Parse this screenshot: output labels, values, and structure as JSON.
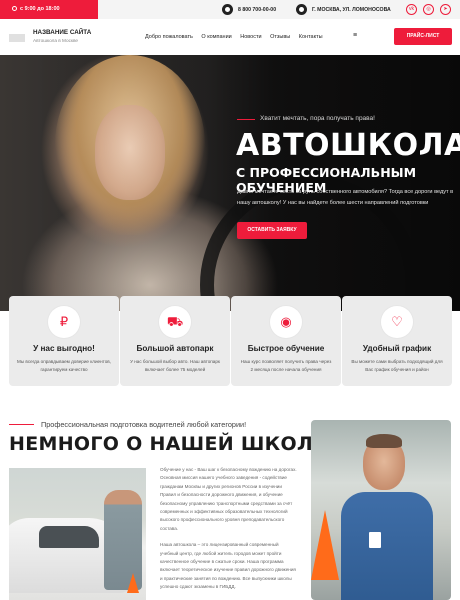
{
  "topbar": {
    "hours": "с 9:00 до 18:00",
    "phone": "8 800 700-00-00",
    "address": "Г. МОСКВА, УЛ. ЛОМОНОСОВА",
    "social_icons": [
      "vk-icon",
      "instagram-icon",
      "telegram-icon"
    ]
  },
  "header": {
    "site_name": "НАЗВАНИЕ САЙТА",
    "site_sub": "Автошкола в Москве",
    "nav": [
      "Добро пожаловать",
      "О компании",
      "Новости",
      "Отзывы",
      "Контакты"
    ],
    "price_button": "ПРАЙС-ЛИСТ"
  },
  "hero": {
    "slogan": "Хватит мечтать, пора получать права!",
    "title": "АВТОШКОЛА",
    "subtitle": "С ПРОФЕССИОНАЛЬНЫМ ОБУЧЕНИЕМ",
    "text": "Давно мечтаете сесть за руль собственного автомобиля? Тогда все дороги ведут в нашу автошколу! У нас вы найдете более шести направлений подготовки",
    "cta": "ОСТАВИТЬ ЗАЯВКУ"
  },
  "features": [
    {
      "icon": "piggy-bank-icon",
      "title": "У нас выгодно!",
      "text": "Мы всегда оправдываем доверие клиентов, гарантируем качество"
    },
    {
      "icon": "car-icon",
      "title": "Большой автопарк",
      "text": "У нас большой выбор авто. Наш автопарк включает более 75 моделей"
    },
    {
      "icon": "steering-wheel-icon",
      "title": "Быстрое обучение",
      "text": "Наш курс позволяет получить права через 2 месяца после начала обучения"
    },
    {
      "icon": "heart-shield-icon",
      "title": "Удобный график",
      "text": "Вы можете сами выбрать подходящий для Вас график обучения и район"
    }
  ],
  "about": {
    "pre": "Профессиональная подготовка водителей любой категории!",
    "heading": "НЕМНОГО О НАШЕЙ ШКОЛЕ",
    "p1": "Обучение у нас - Ваш шаг к безопасному вождению на дорогах. Основная миссия нашего учебного заведения - содействие гражданам Москвы и других регионов России в изучении Правил и безопасности дорожного движения, и обучение безопасному управлению транспортными средствами за счёт современных и эффективных образовательных технологий высокого профессионального уровня преподавательского состава.",
    "p2": "Наша автошкола – это лицензированный современный учебный центр, где любой житель городов может пройти качественное обучение в сжатые сроки. Наша программа включает теоретическое изучение правил дорожного движения и практические занятия по вождению. Все выпускники школы успешно сдают экзамены в ГИБДД."
  }
}
